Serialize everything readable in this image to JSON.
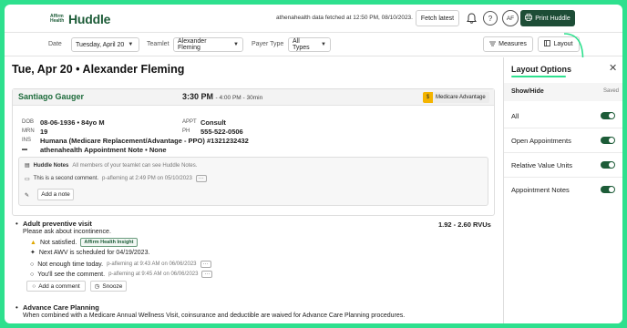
{
  "header": {
    "logo_small": "Affirm Health",
    "logo_big": "Huddle",
    "fetch_status": "athenahealth data fetched at 12:50 PM, 08/10/2023.",
    "fetch_button": "Fetch latest",
    "avatar": "AF",
    "print_button": "Print Huddle",
    "help_glyph": "?",
    "bell_glyph": "🔔"
  },
  "filters": {
    "date_label": "Date",
    "date_value": "Tuesday, April 20",
    "teamlet_label": "Teamlet",
    "teamlet_value": "Alexander Fleming",
    "payer_label": "Payer Type",
    "payer_value": "All Types",
    "measures_button": "Measures",
    "layout_button": "Layout"
  },
  "main": {
    "page_title": "Tue, Apr 20 • Alexander Fleming",
    "patient": {
      "name": "Santiago Gauger",
      "time": "3:30 PM",
      "time_sub": "- 4:00 PM - 30min",
      "badge": "Medicare Advantage",
      "dob_label": "DOB",
      "dob": "08-06-1936 • 84yo M",
      "mrn_label": "MRN",
      "mrn": "19",
      "ins_label": "INS",
      "ins": "Humana (Medicare Replacement/Advantage - PPO) #1321232432",
      "appt_label": "APPT",
      "appt": "Consult",
      "ph_label": "PH",
      "ph": "555-522-0506",
      "appt_note": "athenahealth Appointment Note • None"
    },
    "notes": {
      "title": "Huddle Notes",
      "subtitle": "All members of your teamlet can see Huddle Notes.",
      "comment": "This is a second comment.",
      "comment_meta": "p-afleming at 2:49 PM on 05/10/2023",
      "add_note": "Add a note",
      "dots": "···"
    },
    "measures": [
      {
        "title": "Adult preventive visit",
        "rvu": "1.92 - 2.60 RVUs",
        "desc": "Please ask about incontinence.",
        "status": "Not satisfied.",
        "insight": "Affirm Health Insight",
        "next": "Next AWV is scheduled for 04/19/2023.",
        "c1": "Not enough time today.",
        "c1_meta": "p-afleming at 9:43 AM on 06/06/2023",
        "c2": "You'll see the comment.",
        "c2_meta": "p-afleming at 9:45 AM on 06/06/2023",
        "add_comment": "Add a comment",
        "snooze": "Snooze"
      },
      {
        "title": "Advance Care Planning",
        "desc": "When combined with a Medicare Annual Wellness Visit, coinsurance and deductible are waived for Advance Care Planning procedures."
      }
    ]
  },
  "layout_panel": {
    "title": "Layout Options",
    "show_hide": "Show/Hide",
    "saved": "Saved",
    "options": [
      {
        "label": "All",
        "on": true
      },
      {
        "label": "Open Appointments",
        "on": true
      },
      {
        "label": "Relative Value Units",
        "on": true
      },
      {
        "label": "Appointment Notes",
        "on": true
      }
    ]
  },
  "colors": {
    "brand": "#1d5c38",
    "accent": "#2ee08e",
    "badge": "#f4b400"
  }
}
